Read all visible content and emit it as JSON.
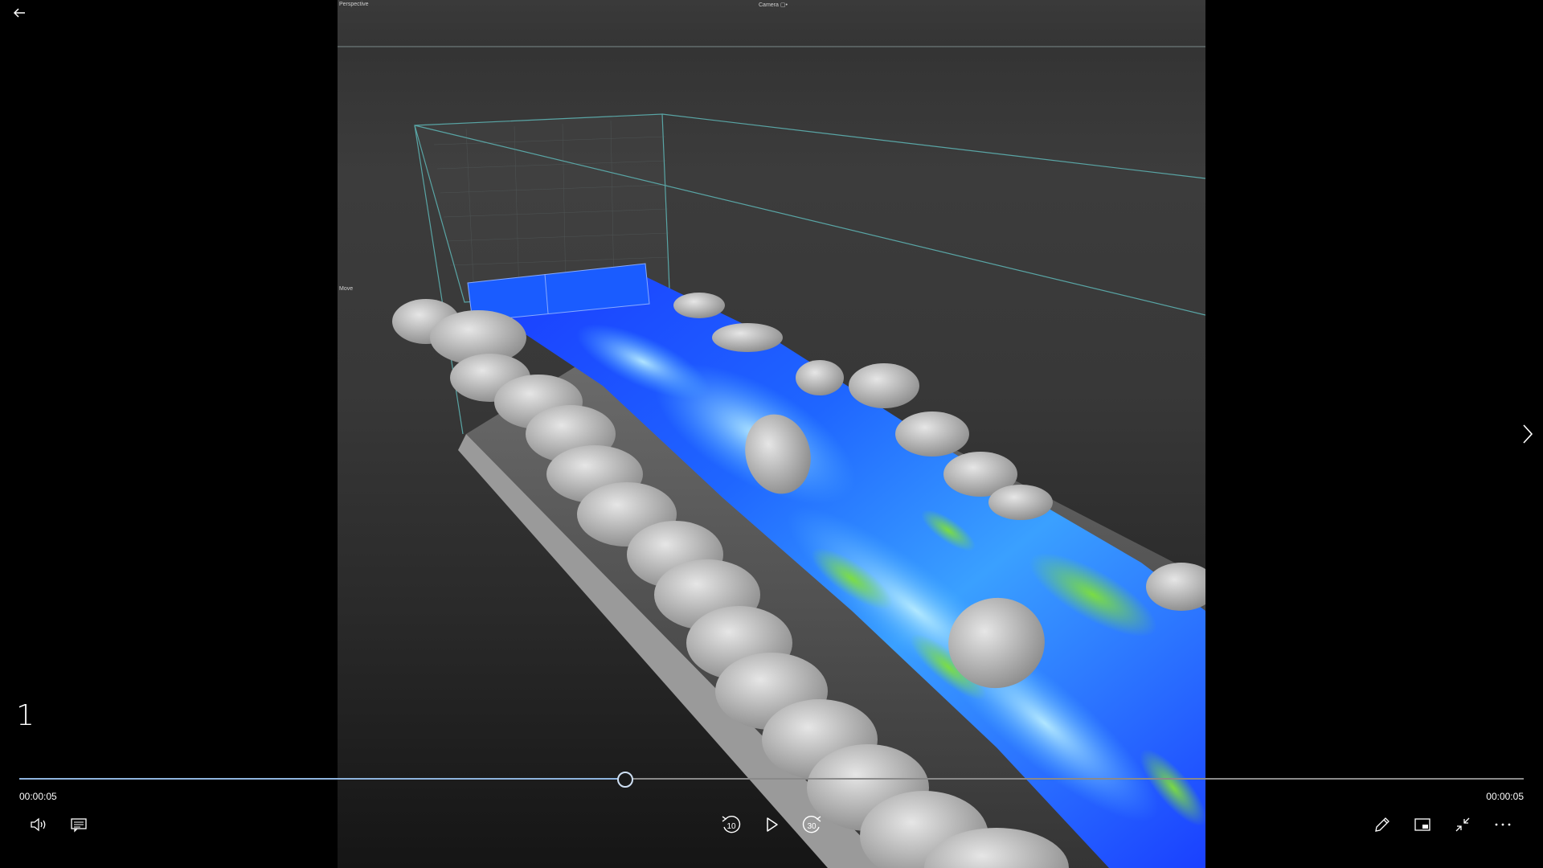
{
  "viewport": {
    "perspective_label": "Perspective",
    "camera_label": "Camera ▢•",
    "move_label": "Move"
  },
  "video": {
    "title": "1",
    "current_time": "00:00:05",
    "total_time": "00:00:05",
    "progress": 0.402
  },
  "controls": {
    "skip_back_seconds": "10",
    "skip_forward_seconds": "30"
  },
  "icons": {
    "back": "back-arrow-icon",
    "next": "chevron-right-icon",
    "volume": "volume-icon",
    "captions": "captions-icon",
    "skip_back": "skip-back-icon",
    "play": "play-icon",
    "skip_forward": "skip-forward-icon",
    "edit": "pencil-icon",
    "mini_view": "mini-view-icon",
    "exit_fullscreen": "exit-fullscreen-icon",
    "more": "more-icon"
  },
  "colors": {
    "accent": "#8fb4de",
    "water_deep": "#0a3cff",
    "water_light": "#6cc8ff",
    "foam": "#7cd63a",
    "rock": "#cfcfcf"
  }
}
